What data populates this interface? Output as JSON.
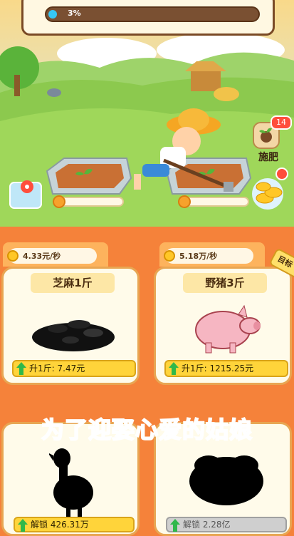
{
  "top_progress": {
    "percent_label": "3%",
    "fraction": 0.03
  },
  "fertilize": {
    "label": "施肥",
    "badge_count": "14"
  },
  "plots": [
    {
      "progress": 0.05
    },
    {
      "progress": 0.05
    }
  ],
  "products": [
    {
      "rate": "4.33元/秒",
      "name": "芝麻1斤",
      "price": "升1斤:  7.47元"
    },
    {
      "rate": "5.18万/秒",
      "name": "野猪3斤",
      "price": "升1斤:  1215.25元"
    }
  ],
  "side_tag": "目标",
  "banner": {
    "part1": "为了迎娶",
    "part2": "心爱的姑娘"
  },
  "locked": [
    {
      "unlock_label": "解锁  426.31万"
    },
    {
      "unlock_label": "解锁  2.28亿"
    }
  ],
  "colors": {
    "accent_orange": "#f5823a",
    "progress_blue": "#36c7f4",
    "gold": "#ffd43a"
  }
}
